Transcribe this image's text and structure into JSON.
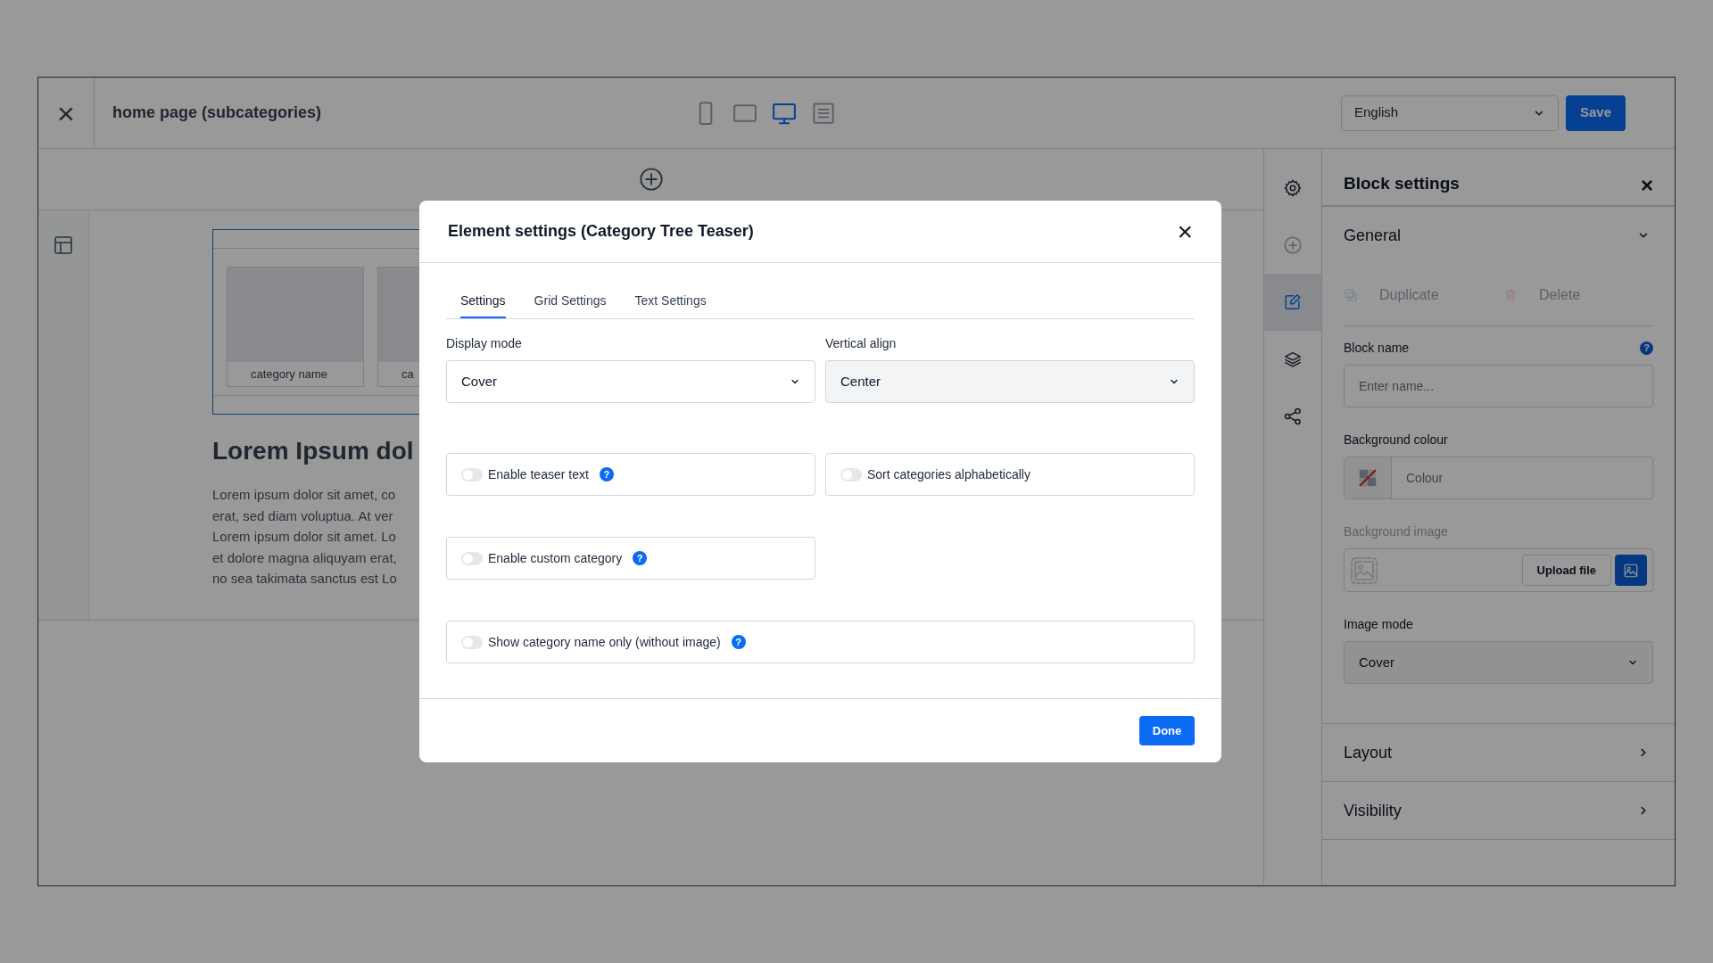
{
  "header": {
    "close": "×",
    "title": "home page (subcategories)",
    "devices": [
      {
        "kind": "phone",
        "selected": false
      },
      {
        "kind": "tablet",
        "selected": false
      },
      {
        "kind": "desktop",
        "selected": true
      },
      {
        "kind": "list",
        "selected": false
      }
    ],
    "language": "English",
    "save": "Save"
  },
  "canvas": {
    "category_cards": [
      "category name",
      "ca"
    ],
    "heading": "Lorem Ipsum dol",
    "paragraph_lines": [
      "Lorem ipsum dolor sit amet, co",
      "erat, sed diam voluptua. At ver",
      "Lorem ipsum dolor sit amet. Lo",
      "et dolore magna aliquyam erat,",
      "no sea takimata sanctus est Lo"
    ]
  },
  "sidebar_icons": [
    {
      "kind": "settings",
      "selected": false
    },
    {
      "kind": "add",
      "selected": false
    },
    {
      "kind": "edit",
      "selected": true
    },
    {
      "kind": "layers",
      "selected": false
    },
    {
      "kind": "share",
      "selected": false
    }
  ],
  "block_settings": {
    "title": "Block settings",
    "close": "×",
    "sections": [
      {
        "title": "General",
        "expanded": true
      },
      {
        "title": "Layout",
        "expanded": false
      },
      {
        "title": "Visibility",
        "expanded": false
      }
    ],
    "actions": [
      {
        "kind": "duplicate",
        "label": "Duplicate",
        "disabled": true
      },
      {
        "kind": "delete",
        "label": "Delete",
        "disabled": true
      }
    ],
    "fields": [
      {
        "kind": "text",
        "label": "Block name",
        "placeholder": "Enter name...",
        "help": "?",
        "disabled": false
      },
      {
        "kind": "colour",
        "label": "Background colour",
        "placeholder": "Colour",
        "disabled": false
      },
      {
        "kind": "image",
        "label": "Background image",
        "button": "Upload file",
        "disabled": true
      },
      {
        "kind": "select",
        "label": "Image mode",
        "value": "Cover",
        "disabled": false
      }
    ]
  },
  "modal": {
    "title": "Element settings (Category Tree Teaser)",
    "close": "×",
    "tabs": [
      {
        "label": "Settings",
        "selected": true
      },
      {
        "label": "Grid Settings",
        "selected": false
      },
      {
        "label": "Text Settings",
        "selected": false
      }
    ],
    "selects": [
      {
        "label": "Display mode",
        "value": "Cover",
        "disabled": false
      },
      {
        "label": "Vertical align",
        "value": "Center",
        "disabled": true
      }
    ],
    "toggle_rows": [
      [
        {
          "label": "Enable teaser text",
          "on": false,
          "help": "?"
        },
        {
          "label": "Sort categories alphabetically",
          "on": false
        }
      ],
      [
        {
          "label": "Enable custom category",
          "on": false,
          "help": "?"
        }
      ],
      [
        {
          "label": "Show category name only (without image)",
          "on": false,
          "help": "?",
          "wide": true
        }
      ]
    ],
    "done": "Done"
  }
}
